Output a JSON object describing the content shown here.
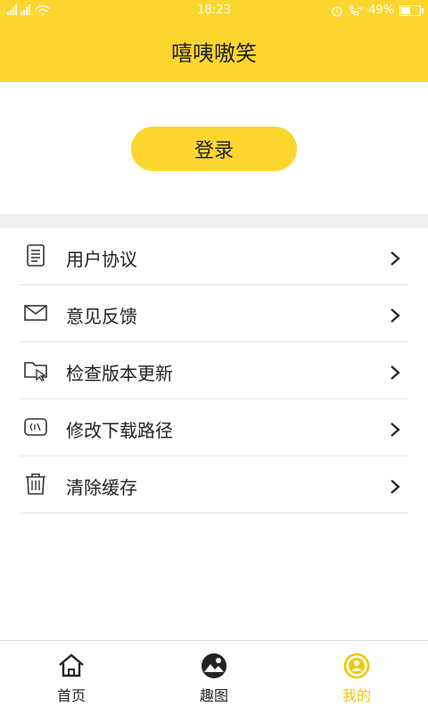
{
  "status_bar": {
    "signals": "▘▘ıl ▘ıl ⌒",
    "time": "18:23",
    "battery_text": "49%",
    "battery_level": 0.49
  },
  "header": {
    "title": "嘻咦嗷笑"
  },
  "login": {
    "label": "登录"
  },
  "menu": {
    "items": [
      {
        "label": "用户协议",
        "icon": "document-icon"
      },
      {
        "label": "意见反馈",
        "icon": "mail-icon"
      },
      {
        "label": "检查版本更新",
        "icon": "folder-cursor-icon"
      },
      {
        "label": "修改下载路径",
        "icon": "storage-card-icon"
      },
      {
        "label": "清除缓存",
        "icon": "trash-icon"
      }
    ]
  },
  "tabbar": {
    "tabs": [
      {
        "label": "首页",
        "icon": "home-icon",
        "active": false
      },
      {
        "label": "趣图",
        "icon": "landscape-icon",
        "active": false
      },
      {
        "label": "我的",
        "icon": "profile-icon",
        "active": true
      }
    ]
  },
  "colors": {
    "accent": "#fcd62f",
    "active_tab": "#f2c800",
    "band": "#efefef"
  }
}
